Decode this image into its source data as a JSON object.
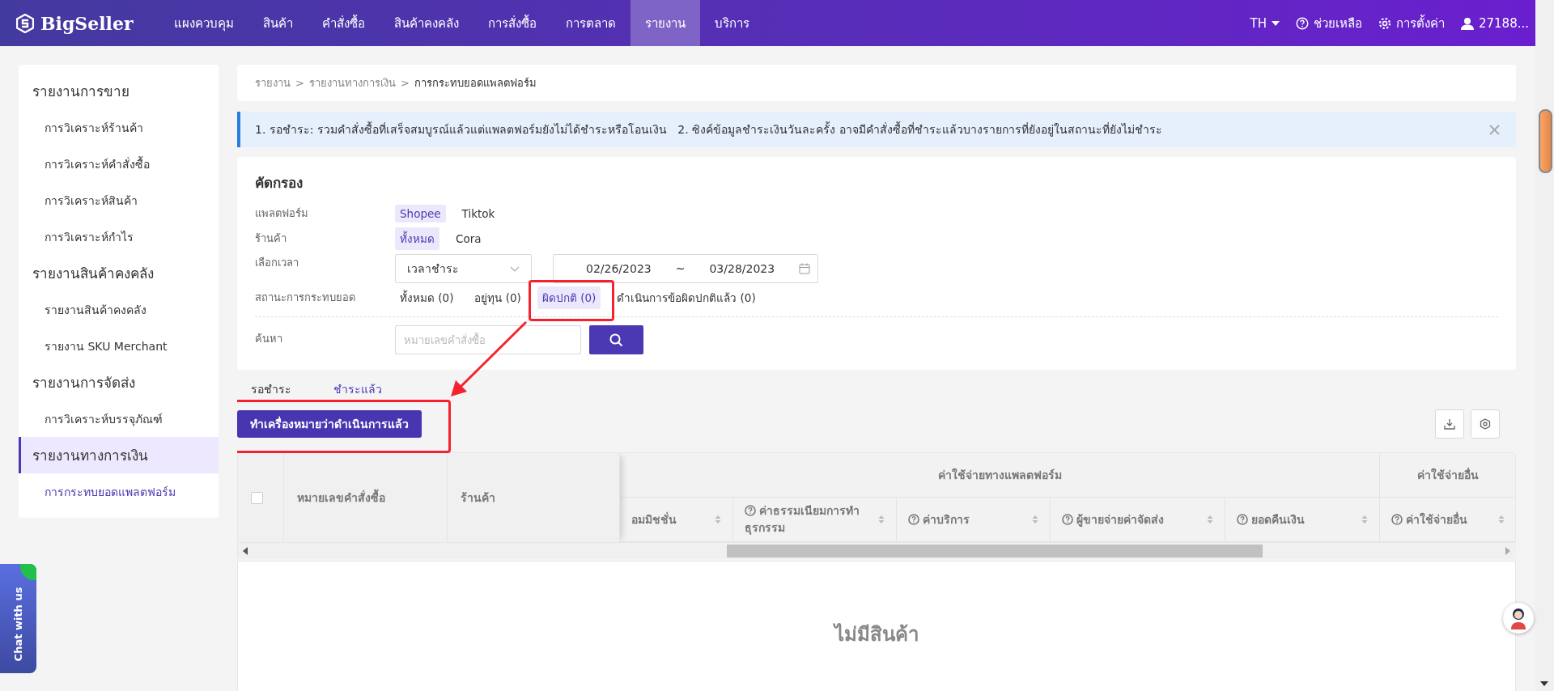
{
  "topbar": {
    "logo": "BigSeller",
    "nav": [
      {
        "label": "แผงควบคุม",
        "selected": false
      },
      {
        "label": "สินค้า",
        "selected": false
      },
      {
        "label": "คำสั่งซื้อ",
        "selected": false
      },
      {
        "label": "สินค้าคงคลัง",
        "selected": false
      },
      {
        "label": "การสั่งซื้อ",
        "selected": false
      },
      {
        "label": "การตลาด",
        "selected": false
      },
      {
        "label": "รายงาน",
        "selected": true
      },
      {
        "label": "บริการ",
        "selected": false
      }
    ],
    "language": "TH",
    "help": "ช่วยเหลือ",
    "settings": "การตั้งค่า",
    "user": "27188..."
  },
  "sidebar": {
    "groups": [
      {
        "label": "รายงานการขาย",
        "selected": false,
        "children": [
          {
            "label": "การวิเคราะห์ร้านค้า",
            "selected": false
          },
          {
            "label": "การวิเคราะห์คำสั่งซื้อ",
            "selected": false
          },
          {
            "label": "การวิเคราะห์สินค้า",
            "selected": false
          },
          {
            "label": "การวิเคราะห์กำไร",
            "selected": false
          }
        ]
      },
      {
        "label": "รายงานสินค้าคงคลัง",
        "selected": false,
        "children": [
          {
            "label": "รายงานสินค้าคงคลัง",
            "selected": false
          },
          {
            "label": "รายงาน SKU Merchant",
            "selected": false
          }
        ]
      },
      {
        "label": "รายงานการจัดส่ง",
        "selected": false,
        "children": [
          {
            "label": "การวิเคราะห์บรรจุภัณฑ์",
            "selected": false
          }
        ]
      },
      {
        "label": "รายงานทางการเงิน",
        "selected": true,
        "children": [
          {
            "label": "การกระทบยอดแพลตฟอร์ม",
            "selected": true
          }
        ]
      }
    ]
  },
  "breadcrumb": {
    "separator": ">",
    "items": [
      "รายงาน",
      "รายงานทางการเงิน",
      "การกระทบยอดแพลตฟอร์ม"
    ]
  },
  "alert": {
    "text": "1. รอชำระ: รวมคำสั่งซื้อที่เสร็จสมบูรณ์แล้วแต่แพลตฟอร์มยังไม่ได้ชำระหรือโอนเงิน   2. ซิงค์ข้อมูลชำระเงินวันละครั้ง อาจมีคำสั่งซื้อที่ชำระแล้วบางรายการที่ยังอยู่ในสถานะที่ยังไม่ชำระ"
  },
  "filter": {
    "title": "คัดกรอง",
    "rows": [
      {
        "kind": "chips",
        "label": "แพลตฟอร์ม",
        "options": [
          {
            "label": "Shopee",
            "selected": true
          },
          {
            "label": "Tiktok",
            "selected": false
          }
        ]
      },
      {
        "kind": "chips",
        "label": "ร้านค้า",
        "options": [
          {
            "label": "ทั้งหมด",
            "selected": true
          },
          {
            "label": "Cora",
            "selected": false
          }
        ]
      },
      {
        "kind": "time",
        "label": "เลือกเวลา",
        "select": "เวลาชำระ",
        "start": "02/26/2023",
        "separator": "~",
        "end": "03/28/2023"
      },
      {
        "kind": "chips",
        "label": "สถานะการกระทบยอด",
        "options": [
          {
            "label": "ทั้งหมด (0)",
            "selected": false
          },
          {
            "label": "อยู่ทุน (0)",
            "selected": false
          },
          {
            "label": "ผิดปกติ (0)",
            "selected": true
          },
          {
            "label": "ดำเนินการข้อผิดปกติแล้ว (0)",
            "selected": false
          }
        ]
      },
      {
        "kind": "search",
        "label": "ค้นหา",
        "placeholder": "หมายเลขคำสั่งซื้อ"
      }
    ]
  },
  "tabs": [
    {
      "label": "รอชำระ",
      "selected": false
    },
    {
      "label": "ชำระแล้ว",
      "selected": true
    }
  ],
  "action_button": "ทำเครื่องหมายว่าดำเนินการแล้ว",
  "table": {
    "select_all": {
      "checked": false
    },
    "frozen_columns": [
      "หมายเลขคำสั่งซื้อ",
      "ร้านค้า"
    ],
    "groups": [
      {
        "label": "ค่าใช้จ่ายทางแพลตฟอร์ม",
        "columns": [
          {
            "label": "อมมิชชั่น",
            "help": false,
            "sortable": true
          },
          {
            "label": "ค่าธรรมเนียมการทำธุรกรรม",
            "help": true,
            "sortable": true
          },
          {
            "label": "ค่าบริการ",
            "help": true,
            "sortable": true
          },
          {
            "label": "ผู้ขายจ่ายค่าจัดส่ง",
            "help": true,
            "sortable": true
          },
          {
            "label": "ยอดคืนเงิน",
            "help": true,
            "sortable": true
          }
        ]
      },
      {
        "label": "ค่าใช้จ่ายอื่น",
        "columns": [
          {
            "label": "ค่าใช้จ่ายอื่น",
            "help": true,
            "sortable": true
          }
        ]
      }
    ],
    "empty_text": "ไม่มีสินค้า"
  },
  "chat_tab": "Chat with us"
}
